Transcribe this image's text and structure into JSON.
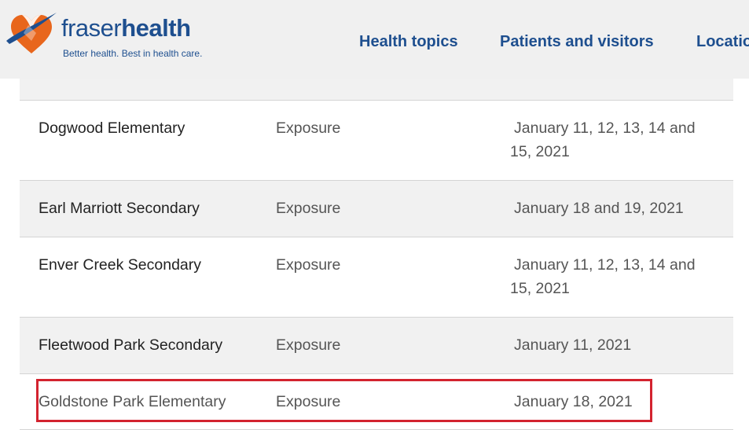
{
  "header": {
    "logo_light": "fraser",
    "logo_bold": "health",
    "tagline": "Better health. Best in health care.",
    "nav": [
      {
        "label": "Health topics"
      },
      {
        "label": "Patients and visitors"
      },
      {
        "label": "Locatio"
      }
    ]
  },
  "table": {
    "rows": [
      {
        "school": "Dogwood Elementary",
        "type": "Exposure",
        "dates": "January 11, 12, 13, 14 and 15, 2021"
      },
      {
        "school": "Earl Marriott Secondary",
        "type": "Exposure",
        "dates": "January 18 and 19, 2021"
      },
      {
        "school": "Enver Creek Secondary",
        "type": "Exposure",
        "dates": "January 11, 12, 13, 14 and 15, 2021"
      },
      {
        "school": "Fleetwood Park Secondary",
        "type": "Exposure",
        "dates": "January 11, 2021"
      },
      {
        "school": "Goldstone Park Elementary",
        "type": "Exposure",
        "dates": "January 18, 2021"
      }
    ]
  },
  "colors": {
    "brand_blue": "#1e4f8f",
    "logo_orange": "#e8661c",
    "highlight_red": "#d3232f"
  },
  "icons": {
    "logo": "fraser-health-heart-logo-icon"
  }
}
